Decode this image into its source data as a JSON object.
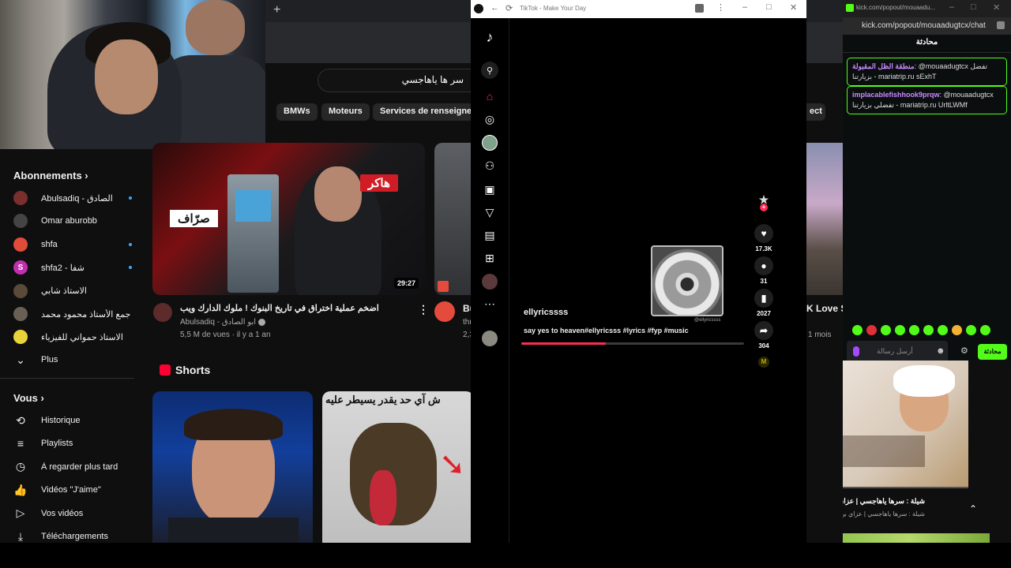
{
  "youtube": {
    "search_value": "سر ها ياهاجسي",
    "chips": [
      "BMWs",
      "Moteurs",
      "Services de renseigneme"
    ],
    "sidebar": {
      "subscriptions_label": "Abonnements",
      "subscriptions": [
        {
          "label": "Abulsadiq - الصادق",
          "dot": true,
          "color": "#7a2e2e",
          "initial": ""
        },
        {
          "label": "Omar aburobb",
          "dot": false,
          "color": "#444",
          "initial": ""
        },
        {
          "label": "shfa",
          "dot": true,
          "color": "#e04b3a",
          "initial": ""
        },
        {
          "label": "shfa2 - شفا",
          "dot": true,
          "color": "#c22fae",
          "initial": "S"
        },
        {
          "label": "الاستاذ شابي",
          "dot": false,
          "color": "#5a4a3a",
          "initial": ""
        },
        {
          "label": "جمع الأستاذ محمود محمد",
          "dot": false,
          "color": "#6a5f55",
          "initial": ""
        },
        {
          "label": "الاستاذ حمواني للفيزياء",
          "dot": false,
          "color": "#e9d33a",
          "initial": ""
        }
      ],
      "more_label": "Plus",
      "you_label": "Vous",
      "you_items": [
        {
          "icon": "history-icon",
          "glyph": "⟲",
          "label": "Historique"
        },
        {
          "icon": "playlists-icon",
          "glyph": "≡",
          "label": "Playlists"
        },
        {
          "icon": "watch-later-icon",
          "glyph": "◷",
          "label": "À regarder plus tard"
        },
        {
          "icon": "liked-videos-icon",
          "glyph": "👍",
          "label": "Vidéos \"J'aime\""
        },
        {
          "icon": "your-videos-icon",
          "glyph": "▷",
          "label": "Vos vidéos"
        },
        {
          "icon": "downloads-icon",
          "glyph": "⤓",
          "label": "Téléchargements"
        }
      ]
    },
    "video": {
      "thumb_tag_red": "هاكر",
      "thumb_tag_white": "صرّاف",
      "duration": "29:27",
      "title": "اضخم عملية اختراق في تاريخ البنوك ! ملوك الدارك ويب",
      "channel": "Abulsadiq - ابو الصادق",
      "meta": "5,5 M de vues · il y a 1 an",
      "next_title_fragment": "Bu",
      "next_meta_fragment": "thr",
      "next_meta_fragment2": "2,3"
    },
    "shorts_label": "Shorts",
    "short2_caption": "ش آي حد يقدر يسيطر عليه"
  },
  "tiktok": {
    "window_title": "TikTok - Make Your Day",
    "username": "ellyricssss",
    "caption": "say yes to heaven#ellyricsss #lyrics #fyp #music",
    "watermark": "@ellyricssss",
    "likes": "17.3K",
    "comments": "31",
    "saves": "2027",
    "shares": "304",
    "progress": 0.38
  },
  "kick": {
    "url_title": "kick.com/popout/mouaadu...",
    "url": "kick.com/popout/mouaadugtcx/chat",
    "chat_title": "محادثة",
    "messages": [
      {
        "user": "منطقة الظل المقبولة",
        "text": ": @mouaadugtcx تفضل بزيارتنا - mariatrip.ru sExhT"
      },
      {
        "user": "implacablefishhook9prqw",
        "text": ": @mouaadugtcx تفضلي بزيارتنا - mariatrip.ru UrltLWMf"
      }
    ],
    "input_placeholder": "أرسل رسالة",
    "send_label": "محادثة"
  },
  "yt2": {
    "chip_fragment": "ect",
    "title_fragment": "K Love St",
    "meta_fragment": "1 mois",
    "bottom_title": "شيلة : سرها ياهاجسي | عزاي بن سحاب |",
    "bottom_meta": "شيلة : سرها ياهاجسي | عزاي بن سحاب | القنا"
  }
}
